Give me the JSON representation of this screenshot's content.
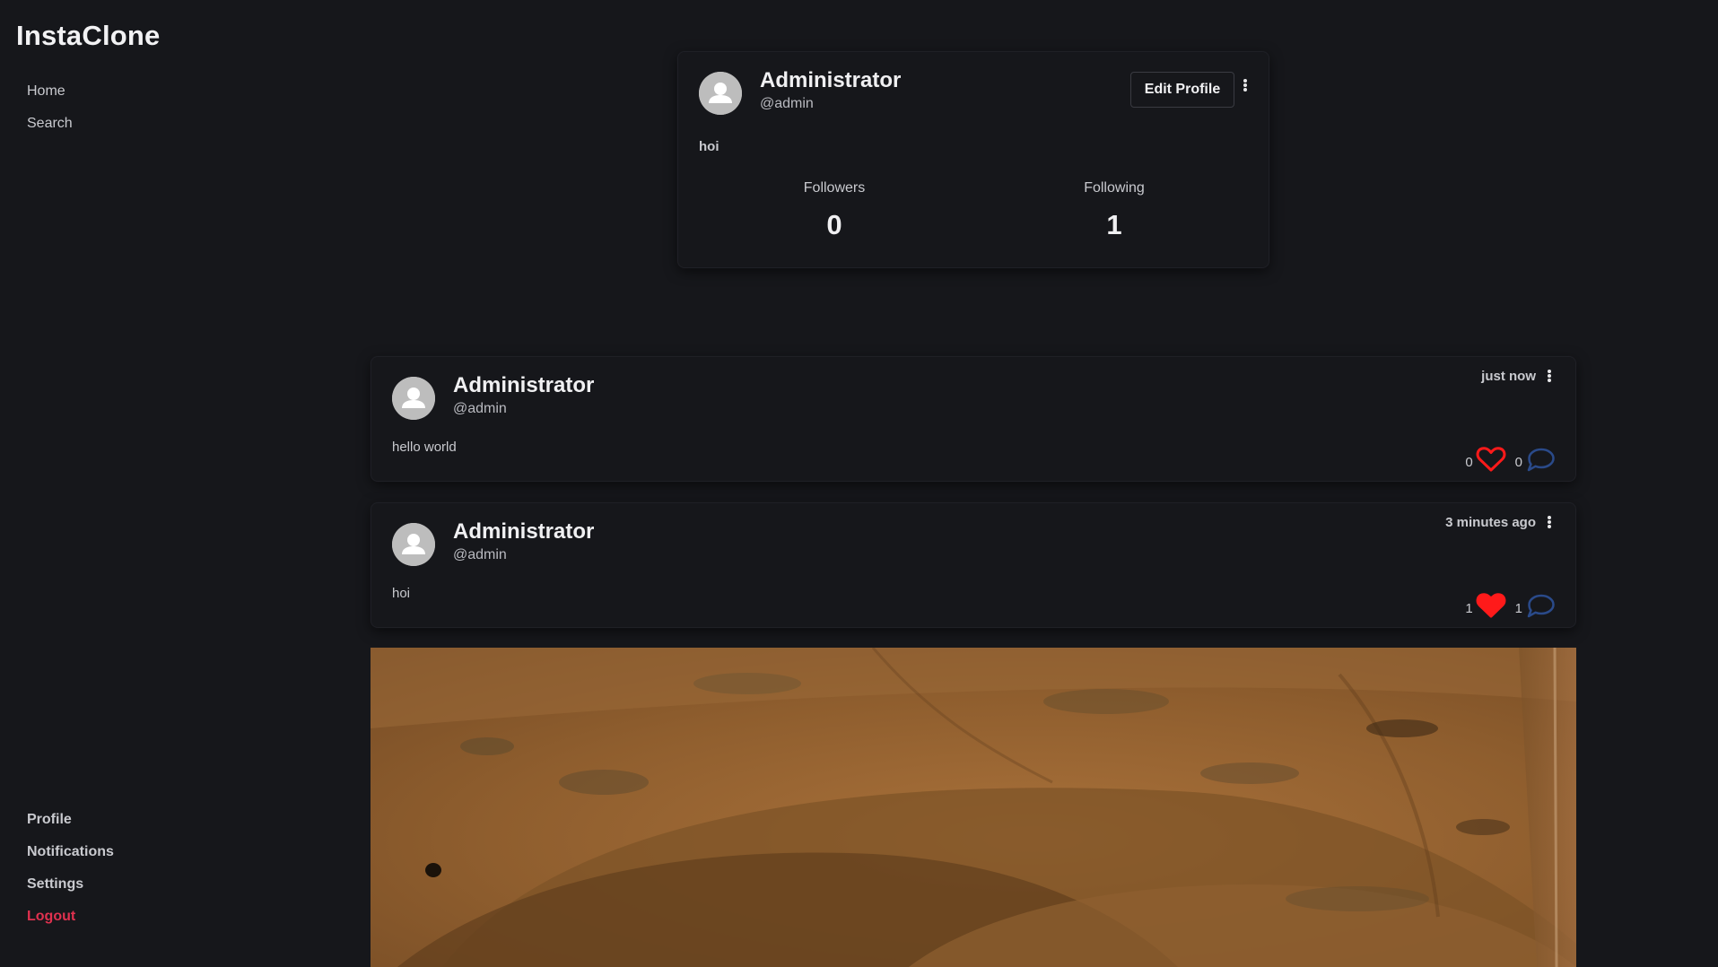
{
  "app": {
    "name": "InstaClone"
  },
  "sidebar": {
    "top_items": [
      {
        "label": "Home"
      },
      {
        "label": "Search"
      }
    ],
    "bottom_items": [
      {
        "label": "Profile"
      },
      {
        "label": "Notifications"
      },
      {
        "label": "Settings"
      },
      {
        "label": "Logout"
      }
    ]
  },
  "profile": {
    "name": "Administrator",
    "handle": "@admin",
    "bio": "hoi",
    "edit_label": "Edit Profile",
    "followers_label": "Followers",
    "followers_value": "0",
    "following_label": "Following",
    "following_value": "1"
  },
  "posts": [
    {
      "name": "Administrator",
      "handle": "@admin",
      "time": "just now",
      "text": "hello world",
      "likes": "0",
      "comments": "0",
      "liked": false
    },
    {
      "name": "Administrator",
      "handle": "@admin",
      "time": "3 minutes ago",
      "text": "hoi",
      "likes": "1",
      "comments": "1",
      "liked": true
    }
  ],
  "colors": {
    "background": "#16171b",
    "like": "#ff1a1a",
    "comment": "#2a4a8a",
    "logout": "#e0314f"
  },
  "icons": [
    "user-avatar-icon",
    "kebab-menu-icon",
    "heart-icon",
    "comment-bubble-icon"
  ]
}
